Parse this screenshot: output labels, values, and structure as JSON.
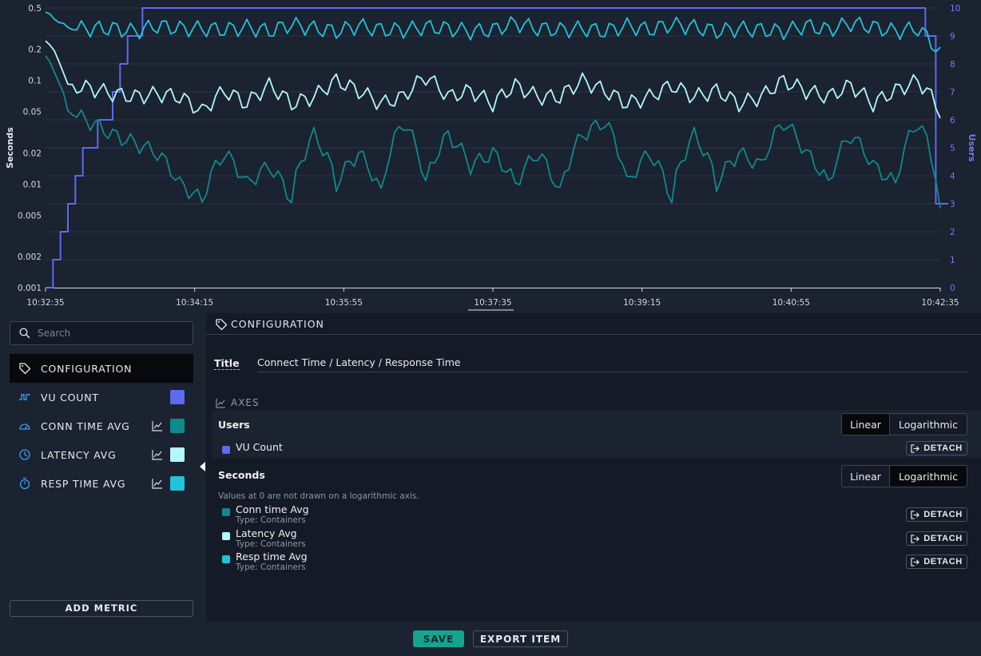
{
  "chart_data": {
    "type": "line",
    "title": "",
    "ylabel": "Seconds",
    "y2label": "Users",
    "yscale": "log",
    "ylim": [
      0.001,
      0.5
    ],
    "y2lim": [
      0,
      10
    ],
    "yticks": [
      "0.5",
      "0.2",
      "0.1",
      "0.05",
      "0.02",
      "0.01",
      "0.005",
      "0.002",
      "0.001"
    ],
    "y2ticks": [
      "0",
      "1",
      "2",
      "3",
      "4",
      "5",
      "6",
      "7",
      "8",
      "9",
      "10"
    ],
    "xticks": [
      "10:32:35",
      "10:34:15",
      "10:35:55",
      "10:37:35",
      "10:39:15",
      "10:40:55",
      "10:42:35"
    ],
    "grid": true,
    "series": [
      {
        "name": "VU Count",
        "axis": "right",
        "color": "#5b6cf0",
        "x_seconds_after_start": [
          0,
          5,
          10,
          15,
          20,
          25,
          30,
          35,
          40,
          45,
          50,
          55,
          60,
          65,
          70,
          75,
          80,
          85,
          90,
          95,
          600,
          595
        ],
        "values": [
          0,
          1,
          2,
          3,
          4,
          5,
          5,
          6,
          6,
          7,
          8,
          9,
          9,
          10,
          10,
          10,
          10,
          10,
          10,
          10,
          3,
          9
        ]
      },
      {
        "name": "Resp time Avg",
        "axis": "left",
        "color": "#1fc3dc",
        "approx_values": [
          0.45,
          0.32,
          0.32,
          0.32,
          0.3,
          0.34,
          0.32,
          0.32,
          0.31,
          0.33,
          0.3,
          0.35,
          0.32,
          0.3,
          0.34,
          0.31,
          0.31,
          0.33,
          0.32,
          0.3,
          0.31,
          0.36,
          0.32,
          0.31,
          0.32,
          0.3,
          0.34,
          0.31,
          0.35,
          0.33,
          0.3,
          0.32,
          0.31,
          0.3,
          0.34,
          0.31,
          0.36,
          0.33,
          0.3,
          0.32,
          0.18
        ]
      },
      {
        "name": "Latency Avg",
        "axis": "left",
        "color": "#b2f7fb",
        "approx_values": [
          0.25,
          0.09,
          0.085,
          0.075,
          0.07,
          0.075,
          0.07,
          0.05,
          0.08,
          0.06,
          0.09,
          0.06,
          0.07,
          0.1,
          0.08,
          0.06,
          0.07,
          0.11,
          0.07,
          0.08,
          0.06,
          0.09,
          0.07,
          0.07,
          0.1,
          0.08,
          0.06,
          0.07,
          0.09,
          0.07,
          0.08,
          0.06,
          0.07,
          0.1,
          0.08,
          0.07,
          0.09,
          0.06,
          0.08,
          0.1,
          0.05
        ]
      },
      {
        "name": "Conn time Avg",
        "axis": "left",
        "color": "#0f8a8d",
        "approx_values": [
          0.17,
          0.05,
          0.04,
          0.03,
          0.025,
          0.02,
          0.01,
          0.007,
          0.02,
          0.01,
          0.015,
          0.007,
          0.03,
          0.01,
          0.02,
          0.008,
          0.04,
          0.01,
          0.03,
          0.015,
          0.02,
          0.01,
          0.02,
          0.008,
          0.03,
          0.04,
          0.01,
          0.02,
          0.007,
          0.03,
          0.01,
          0.02,
          0.015,
          0.04,
          0.02,
          0.01,
          0.03,
          0.015,
          0.01,
          0.04,
          0.005
        ]
      }
    ]
  },
  "sidebar": {
    "search_placeholder": "Search",
    "items": [
      {
        "label": "CONFIGURATION",
        "icon": "tag-icon"
      },
      {
        "label": "VU COUNT",
        "icon": "step-wave-icon",
        "color": "#5b6cf0"
      },
      {
        "label": "CONN TIME AVG",
        "icon": "gauge-icon",
        "color": "#0f8a8d"
      },
      {
        "label": "LATENCY AVG",
        "icon": "clock-icon",
        "color": "#b2f7fb"
      },
      {
        "label": "RESP TIME AVG",
        "icon": "stopwatch-icon",
        "color": "#1fc3dc"
      }
    ],
    "add_metric_label": "ADD METRIC"
  },
  "panel": {
    "header": "CONFIGURATION",
    "title_label": "Title",
    "title_value": "Connect Time / Latency / Response Time",
    "axes_label": "AXES",
    "users": {
      "title": "Users",
      "scale_options": [
        "Linear",
        "Logarithmic"
      ],
      "selected": "Linear",
      "series": [
        {
          "name": "VU Count",
          "color": "#5b6cf0"
        }
      ]
    },
    "seconds": {
      "title": "Seconds",
      "scale_options": [
        "Linear",
        "Logarithmic"
      ],
      "selected": "Logarithmic",
      "note": "Values at 0 are not drawn on a logarithmic axis.",
      "series": [
        {
          "name": "Conn time Avg",
          "type": "Type: Containers",
          "color": "#0f8a8d"
        },
        {
          "name": "Latency Avg",
          "type": "Type: Containers",
          "color": "#b2f7fb"
        },
        {
          "name": "Resp time Avg",
          "type": "Type: Containers",
          "color": "#1fc3dc"
        }
      ]
    },
    "detach_label": "DETACH"
  },
  "footer": {
    "save_label": "SAVE",
    "export_label": "EXPORT ITEM"
  }
}
